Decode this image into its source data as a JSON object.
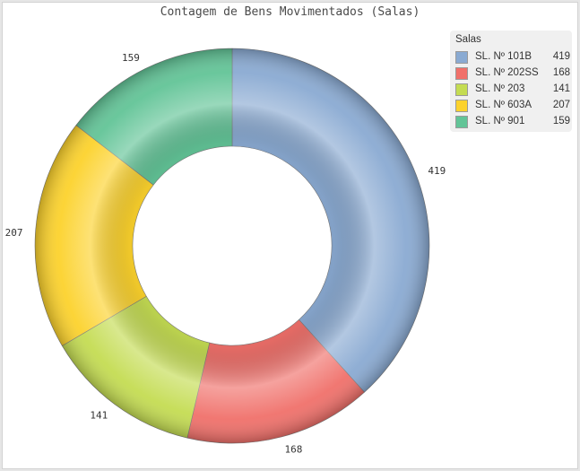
{
  "chart_data": {
    "type": "pie",
    "title": "Contagem de Bens Movimentados (Salas)",
    "categories": [
      "SL. Nº 101B",
      "SL. Nº 202SS",
      "SL. Nº 203",
      "SL. Nº 603A",
      "SL. Nº 901"
    ],
    "values": [
      419,
      168,
      141,
      207,
      159
    ],
    "colors": [
      "#8aaad2",
      "#f0706a",
      "#c4dc52",
      "#fcd22c",
      "#62c497"
    ],
    "donut": true,
    "legend": {
      "title": "Salas",
      "position": "top-right"
    }
  }
}
